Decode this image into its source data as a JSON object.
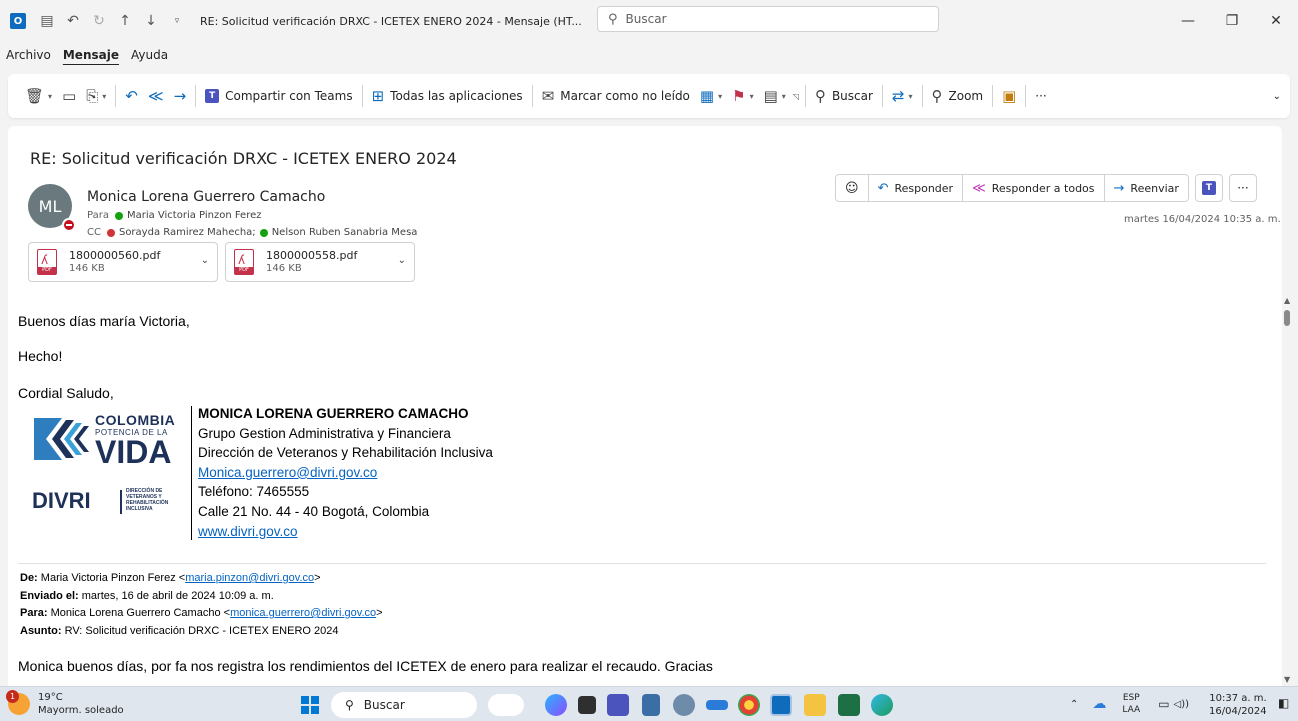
{
  "window": {
    "title": "RE: Solicitud verificación DRXC - ICETEX ENERO 2024  -  Mensaje (HT...",
    "search_placeholder": "Buscar"
  },
  "menu": {
    "items": [
      "Archivo",
      "Mensaje",
      "Ayuda"
    ],
    "active": "Mensaje"
  },
  "ribbon": {
    "share_teams": "Compartir con Teams",
    "all_apps": "Todas las aplicaciones",
    "mark_unread": "Marcar como no leído",
    "search": "Buscar",
    "zoom": "Zoom",
    "more": "···"
  },
  "message": {
    "subject": "RE: Solicitud verificación DRXC - ICETEX ENERO 2024",
    "avatar_initials": "ML",
    "sender": "Monica Lorena Guerrero Camacho",
    "to_label": "Para",
    "to": "Maria Victoria Pinzon Ferez",
    "cc_label": "CC",
    "cc": [
      "Sorayda Ramirez Mahecha;",
      "Nelson Ruben Sanabria Mesa"
    ],
    "date": "martes 16/04/2024 10:35 a. m.",
    "attachments": [
      {
        "name": "1800000560.pdf",
        "size": "146 KB"
      },
      {
        "name": "1800000558.pdf",
        "size": "146 KB"
      }
    ],
    "actions": {
      "reply": "Responder",
      "reply_all": "Responder a todos",
      "forward": "Reenviar",
      "more": "···"
    }
  },
  "body": {
    "greeting": "Buenos días maría Victoria,",
    "line1": "Hecho!",
    "closing": "Cordial Saludo,",
    "signature": {
      "logo_colombia": "COLOMBIA",
      "logo_potencia": "POTENCIA DE LA",
      "logo_vida": "VIDA",
      "logo_divri": "DIVRI",
      "logo_divri_sub": "DIRECCIÓN DE VETERANOS Y REHABILITACIÓN INCLUSIVA",
      "name": "MONICA LORENA GUERRERO CAMACHO",
      "group": "Grupo Gestion Administrativa y Financiera",
      "direction": "Dirección de Veteranos y Rehabilitación Inclusiva",
      "email": "Monica.guerrero@divri.gov.co",
      "phone": "Teléfono: 7465555",
      "address": "Calle 21 No. 44 - 40 Bogotá, Colombia",
      "web": "www.divri.gov.co"
    },
    "forwarded": {
      "from_label": "De:",
      "from_name": "Maria Victoria Pinzon Ferez <",
      "from_email": "maria.pinzon@divri.gov.co",
      "from_end": ">",
      "sent_label": "Enviado el:",
      "sent": "martes, 16 de abril de 2024 10:09 a. m.",
      "to_label": "Para:",
      "to_name": "Monica Lorena Guerrero Camacho <",
      "to_email": "monica.guerrero@divri.gov.co",
      "to_end": ">",
      "subject_label": "Asunto:",
      "subject": "RV: Solicitud verificación DRXC - ICETEX ENERO 2024"
    },
    "last_line": "Monica buenos días, por fa nos registra los rendimientos del ICETEX de enero para realizar el recaudo. Gracias"
  },
  "taskbar": {
    "weather_temp": "19°C",
    "weather_desc": "Mayorm. soleado",
    "weather_badge": "1",
    "search": "Buscar",
    "lang_1": "ESP",
    "lang_2": "LAA",
    "time": "10:37 a. m.",
    "date": "16/04/2024"
  },
  "colors": {
    "accent": "#0f6cbd",
    "brand_navy": "#1d3159",
    "link": "#0563c1"
  }
}
